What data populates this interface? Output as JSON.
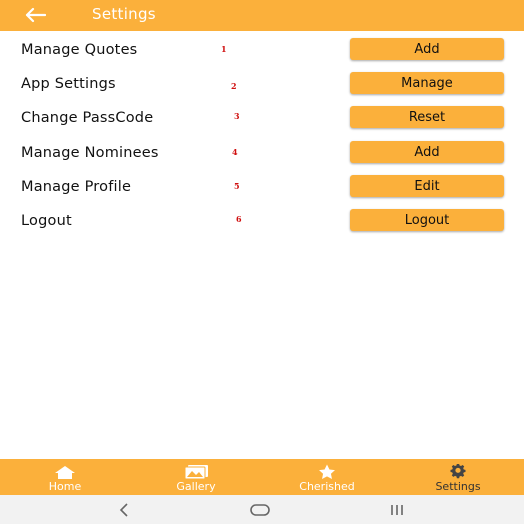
{
  "appbar": {
    "title": "Settings",
    "back_icon": "arrow-left-icon"
  },
  "rows": [
    {
      "label": "Manage Quotes",
      "number": "1",
      "button": "Add"
    },
    {
      "label": "App Settings",
      "number": "2",
      "button": "Manage"
    },
    {
      "label": "Change PassCode",
      "number": "3",
      "button": "Reset"
    },
    {
      "label": "Manage Nominees",
      "number": "4",
      "button": "Add"
    },
    {
      "label": "Manage Profile",
      "number": "5",
      "button": "Edit"
    },
    {
      "label": "Logout",
      "number": "6",
      "button": "Logout"
    }
  ],
  "bottom_nav": {
    "items": [
      {
        "label": "Home",
        "icon": "home-icon"
      },
      {
        "label": "Gallery",
        "icon": "gallery-icon"
      },
      {
        "label": "Cherished",
        "icon": "star-icon"
      },
      {
        "label": "Settings",
        "icon": "gear-icon",
        "active": true
      }
    ]
  },
  "colors": {
    "accent": "#fbb03b",
    "number_red": "#d01010",
    "text": "#111111"
  }
}
